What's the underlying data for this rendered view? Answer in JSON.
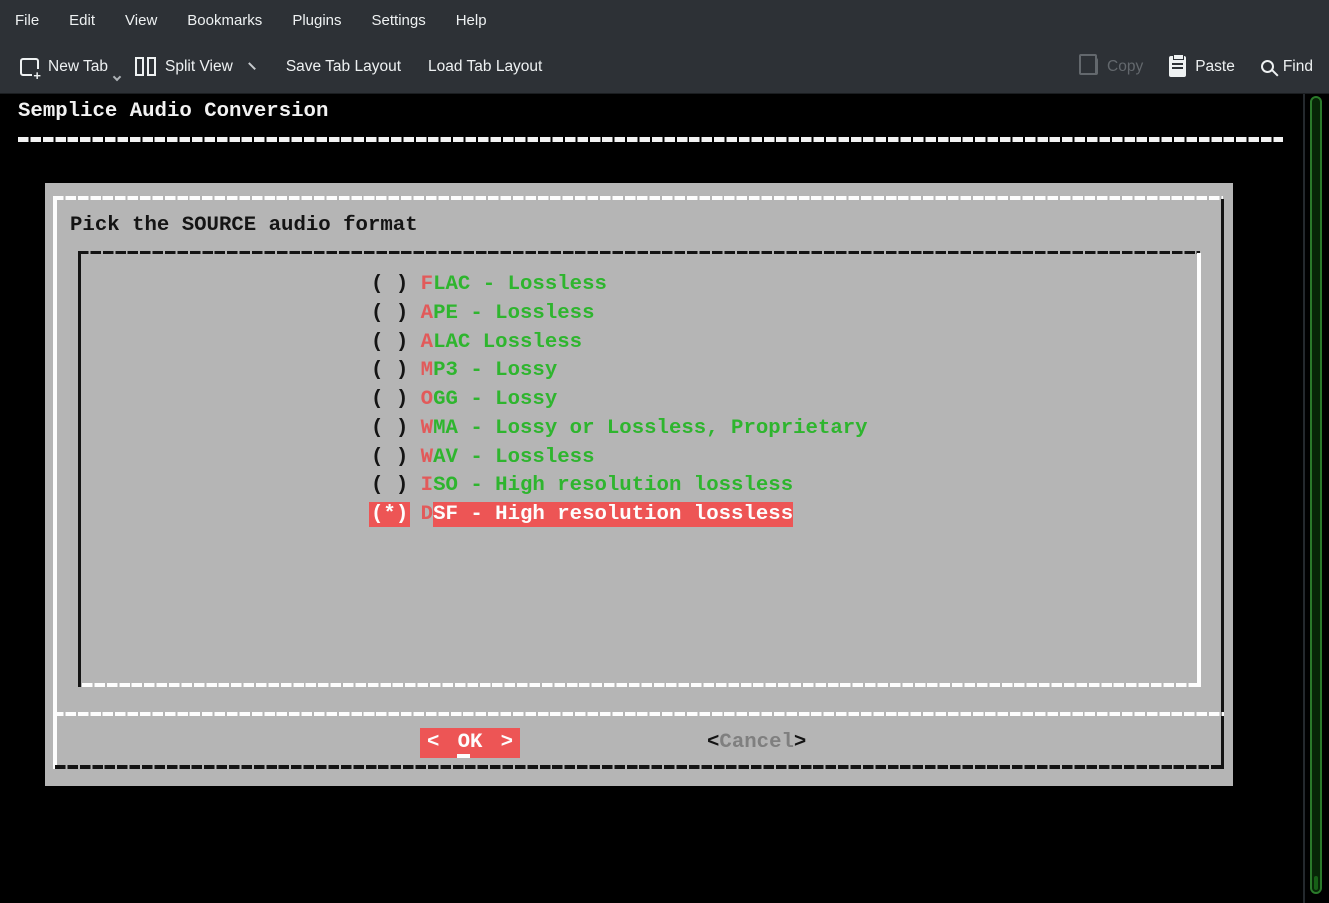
{
  "menu_bar": {
    "items": [
      "File",
      "Edit",
      "View",
      "Bookmarks",
      "Plugins",
      "Settings",
      "Help"
    ]
  },
  "toolbar": {
    "new_tab_label": "New Tab",
    "split_view_label": "Split View",
    "save_tab_layout_label": "Save Tab Layout",
    "load_tab_layout_label": "Load Tab Layout",
    "copy_label": "Copy",
    "paste_label": "Paste",
    "find_label": "Find"
  },
  "terminal": {
    "title": "Semplice Audio Conversion",
    "dialog": {
      "title": "Pick the SOURCE audio format",
      "items": [
        {
          "radio": "( )",
          "hotkey": "F",
          "rest": "LAC - Lossless",
          "selected": false
        },
        {
          "radio": "( )",
          "hotkey": "A",
          "rest": "PE - Lossless",
          "selected": false
        },
        {
          "radio": "( )",
          "hotkey": "A",
          "rest": "LAC Lossless",
          "selected": false
        },
        {
          "radio": "( )",
          "hotkey": "M",
          "rest": "P3 - Lossy",
          "selected": false
        },
        {
          "radio": "( )",
          "hotkey": "O",
          "rest": "GG - Lossy",
          "selected": false
        },
        {
          "radio": "( )",
          "hotkey": "W",
          "rest": "MA - Lossy or Lossless, Proprietary",
          "selected": false
        },
        {
          "radio": "( )",
          "hotkey": "W",
          "rest": "AV - Lossless",
          "selected": false
        },
        {
          "radio": "( )",
          "hotkey": "I",
          "rest": "SO - High resolution lossless",
          "selected": false
        },
        {
          "radio": "(*)",
          "hotkey": "D",
          "rest": "SF - High resolution lossless",
          "selected": true
        }
      ],
      "buttons": {
        "ok": {
          "left_bracket": "<",
          "label": "OK",
          "right_bracket": ">"
        },
        "cancel": {
          "left_bracket": "<",
          "label": "Cancel",
          "right_bracket": ">"
        }
      }
    }
  },
  "colors": {
    "chrome_background": "#2d3136",
    "terminal_background": "#000000",
    "dialog_background": "#b5b5b5",
    "highlight_red": "#ed5555",
    "hotkey_red": "#e25a5a",
    "list_green": "#2eb52e",
    "scrollbar_green": "#2a7a2a",
    "disabled_text": "#63686d"
  }
}
